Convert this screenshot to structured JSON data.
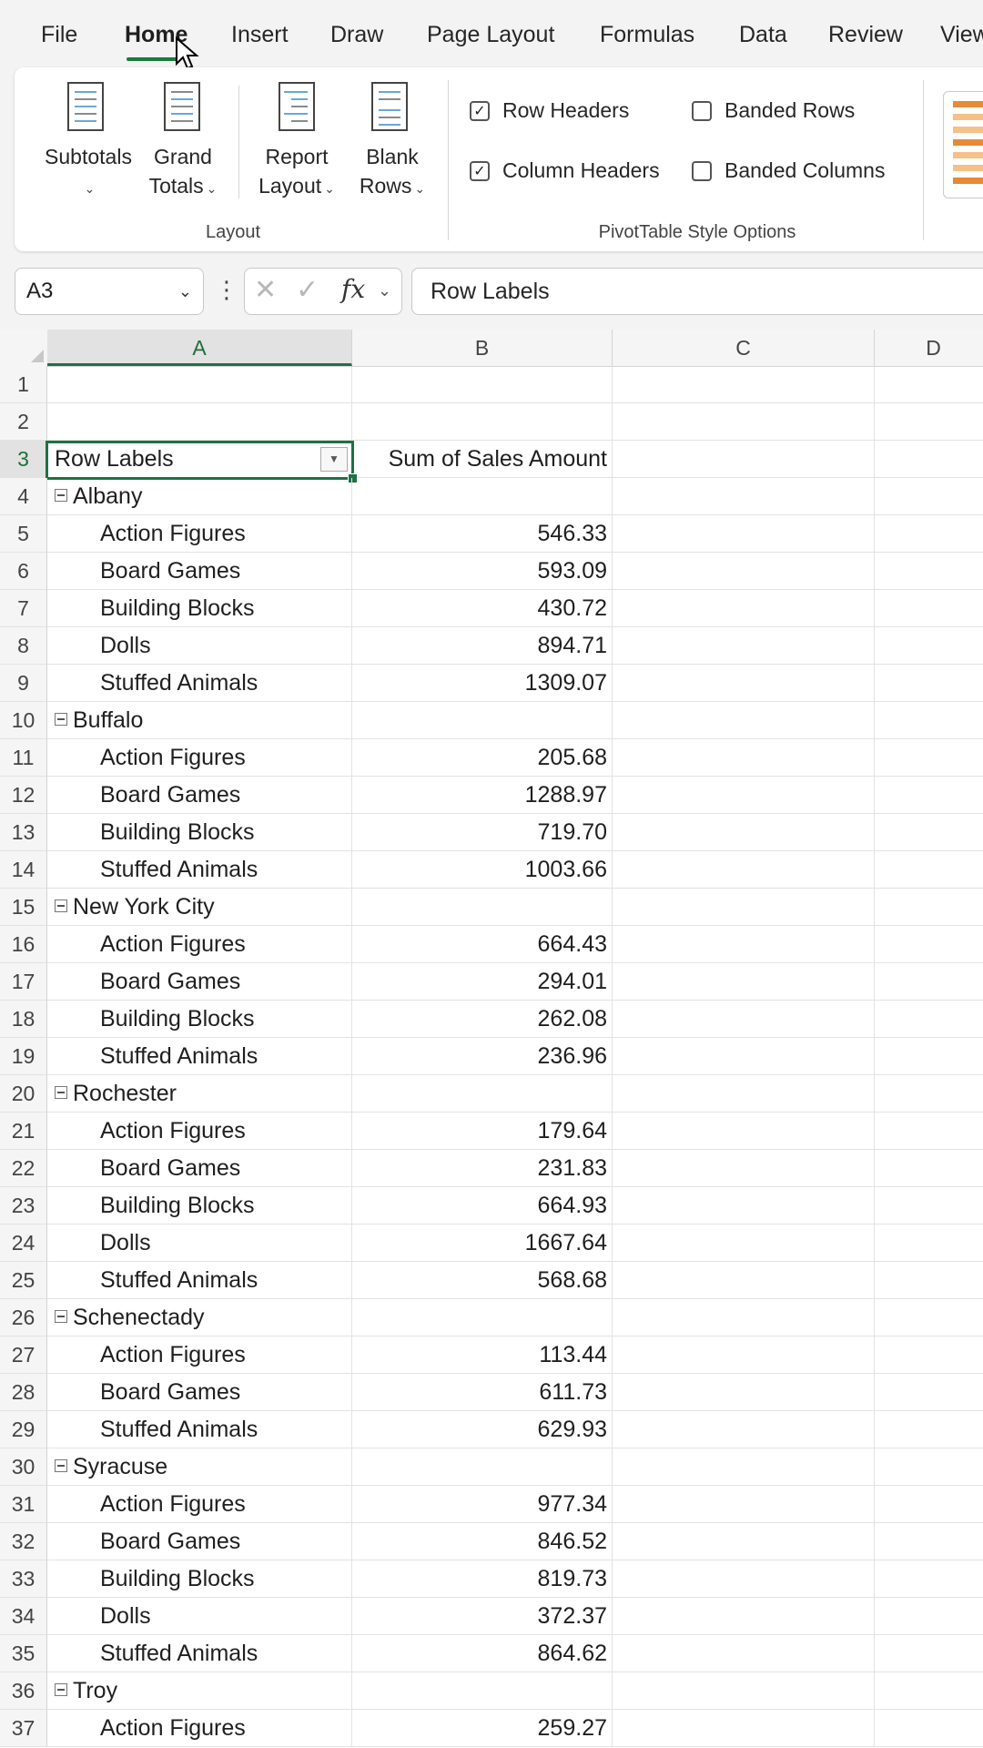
{
  "menu": {
    "tabs": [
      "File",
      "Home",
      "Insert",
      "Draw",
      "Page Layout",
      "Formulas",
      "Data",
      "Review",
      "View"
    ],
    "active": "Home"
  },
  "ribbon": {
    "layout": {
      "label": "Layout",
      "subtotals": "Subtotals",
      "grand_totals_1": "Grand",
      "grand_totals_2": "Totals",
      "report_layout_1": "Report",
      "report_layout_2": "Layout",
      "blank_rows_1": "Blank",
      "blank_rows_2": "Rows"
    },
    "style_options": {
      "label": "PivotTable Style Options",
      "row_headers": "Row Headers",
      "column_headers": "Column Headers",
      "banded_rows": "Banded Rows",
      "banded_columns": "Banded Columns",
      "row_headers_checked": true,
      "column_headers_checked": true,
      "banded_rows_checked": false,
      "banded_columns_checked": false
    }
  },
  "formula_bar": {
    "name_box": "A3",
    "formula": "Row Labels"
  },
  "grid": {
    "columns": [
      "A",
      "B",
      "C",
      "D"
    ],
    "rows": [
      {
        "n": "1",
        "type": "empty",
        "a": "",
        "b": ""
      },
      {
        "n": "2",
        "type": "empty",
        "a": "",
        "b": ""
      },
      {
        "n": "3",
        "type": "header",
        "a": "Row Labels",
        "b": "Sum of Sales Amount"
      },
      {
        "n": "4",
        "type": "group",
        "a": "Albany",
        "b": ""
      },
      {
        "n": "5",
        "type": "item",
        "a": "Action Figures",
        "b": "546.33"
      },
      {
        "n": "6",
        "type": "item",
        "a": "Board Games",
        "b": "593.09"
      },
      {
        "n": "7",
        "type": "item",
        "a": "Building Blocks",
        "b": "430.72"
      },
      {
        "n": "8",
        "type": "item",
        "a": "Dolls",
        "b": "894.71"
      },
      {
        "n": "9",
        "type": "item",
        "a": "Stuffed Animals",
        "b": "1309.07"
      },
      {
        "n": "10",
        "type": "group",
        "a": "Buffalo",
        "b": ""
      },
      {
        "n": "11",
        "type": "item",
        "a": "Action Figures",
        "b": "205.68"
      },
      {
        "n": "12",
        "type": "item",
        "a": "Board Games",
        "b": "1288.97"
      },
      {
        "n": "13",
        "type": "item",
        "a": "Building Blocks",
        "b": "719.70"
      },
      {
        "n": "14",
        "type": "item",
        "a": "Stuffed Animals",
        "b": "1003.66"
      },
      {
        "n": "15",
        "type": "group",
        "a": "New York City",
        "b": ""
      },
      {
        "n": "16",
        "type": "item",
        "a": "Action Figures",
        "b": "664.43"
      },
      {
        "n": "17",
        "type": "item",
        "a": "Board Games",
        "b": "294.01"
      },
      {
        "n": "18",
        "type": "item",
        "a": "Building Blocks",
        "b": "262.08"
      },
      {
        "n": "19",
        "type": "item",
        "a": "Stuffed Animals",
        "b": "236.96"
      },
      {
        "n": "20",
        "type": "group",
        "a": "Rochester",
        "b": ""
      },
      {
        "n": "21",
        "type": "item",
        "a": "Action Figures",
        "b": "179.64"
      },
      {
        "n": "22",
        "type": "item",
        "a": "Board Games",
        "b": "231.83"
      },
      {
        "n": "23",
        "type": "item",
        "a": "Building Blocks",
        "b": "664.93"
      },
      {
        "n": "24",
        "type": "item",
        "a": "Dolls",
        "b": "1667.64"
      },
      {
        "n": "25",
        "type": "item",
        "a": "Stuffed Animals",
        "b": "568.68"
      },
      {
        "n": "26",
        "type": "group",
        "a": "Schenectady",
        "b": ""
      },
      {
        "n": "27",
        "type": "item",
        "a": "Action Figures",
        "b": "113.44"
      },
      {
        "n": "28",
        "type": "item",
        "a": "Board Games",
        "b": "611.73"
      },
      {
        "n": "29",
        "type": "item",
        "a": "Stuffed Animals",
        "b": "629.93"
      },
      {
        "n": "30",
        "type": "group",
        "a": "Syracuse",
        "b": ""
      },
      {
        "n": "31",
        "type": "item",
        "a": "Action Figures",
        "b": "977.34"
      },
      {
        "n": "32",
        "type": "item",
        "a": "Board Games",
        "b": "846.52"
      },
      {
        "n": "33",
        "type": "item",
        "a": "Building Blocks",
        "b": "819.73"
      },
      {
        "n": "34",
        "type": "item",
        "a": "Dolls",
        "b": "372.37"
      },
      {
        "n": "35",
        "type": "item",
        "a": "Stuffed Animals",
        "b": "864.62"
      },
      {
        "n": "36",
        "type": "group",
        "a": "Troy",
        "b": ""
      },
      {
        "n": "37",
        "type": "item",
        "a": "Action Figures",
        "b": "259.27"
      }
    ]
  }
}
